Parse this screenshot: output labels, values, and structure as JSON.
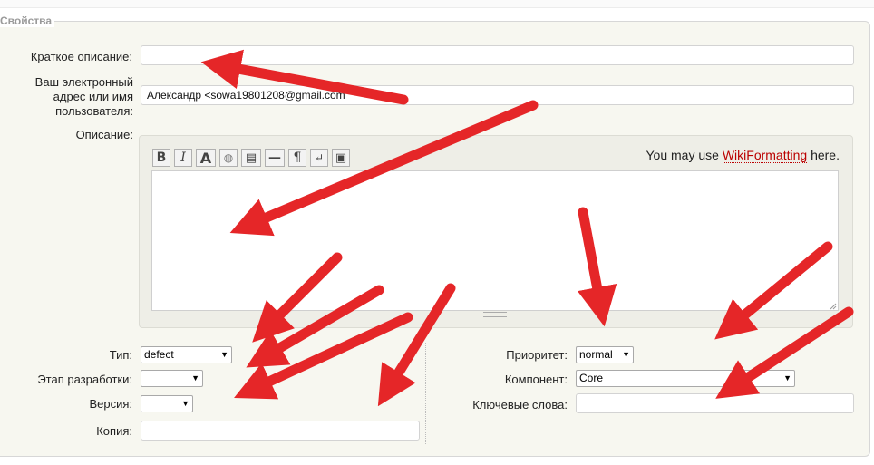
{
  "legend": "Свойства",
  "fields": {
    "summary": {
      "label": "Краткое описание:",
      "value": ""
    },
    "reporter": {
      "label_lines": [
        "Ваш электронный",
        "адрес или имя",
        "пользователя:"
      ],
      "value": "Александр <sowa19801208@gmail.com"
    },
    "description": {
      "label": "Описание:",
      "value": ""
    },
    "type": {
      "label": "Тип:",
      "value": "defect"
    },
    "milestone": {
      "label": "Этап разработки:",
      "value": ""
    },
    "version": {
      "label": "Версия:",
      "value": ""
    },
    "cc": {
      "label": "Копия:",
      "value": ""
    },
    "priority": {
      "label": "Приоритет:",
      "value": "normal"
    },
    "component": {
      "label": "Компонент:",
      "value": "Core"
    },
    "keywords": {
      "label": "Ключевые слова:",
      "value": ""
    }
  },
  "toolbar": {
    "buttons": [
      {
        "name": "bold-icon",
        "glyph": "B"
      },
      {
        "name": "italic-icon",
        "glyph": "I"
      },
      {
        "name": "heading-icon",
        "glyph": "A"
      },
      {
        "name": "link-icon",
        "glyph": "◍"
      },
      {
        "name": "code-block-icon",
        "glyph": "▤"
      },
      {
        "name": "horizontal-rule-icon",
        "glyph": "—"
      },
      {
        "name": "paragraph-icon",
        "glyph": "¶"
      },
      {
        "name": "line-break-icon",
        "glyph": "↵"
      },
      {
        "name": "image-icon",
        "glyph": "▣"
      }
    ]
  },
  "wiki_hint": {
    "before": "You may use ",
    "link": "WikiFormatting",
    "after": " here."
  },
  "colors": {
    "arrow": "#e52628",
    "link": "#bb0000",
    "panel": "#f7f7f0"
  }
}
